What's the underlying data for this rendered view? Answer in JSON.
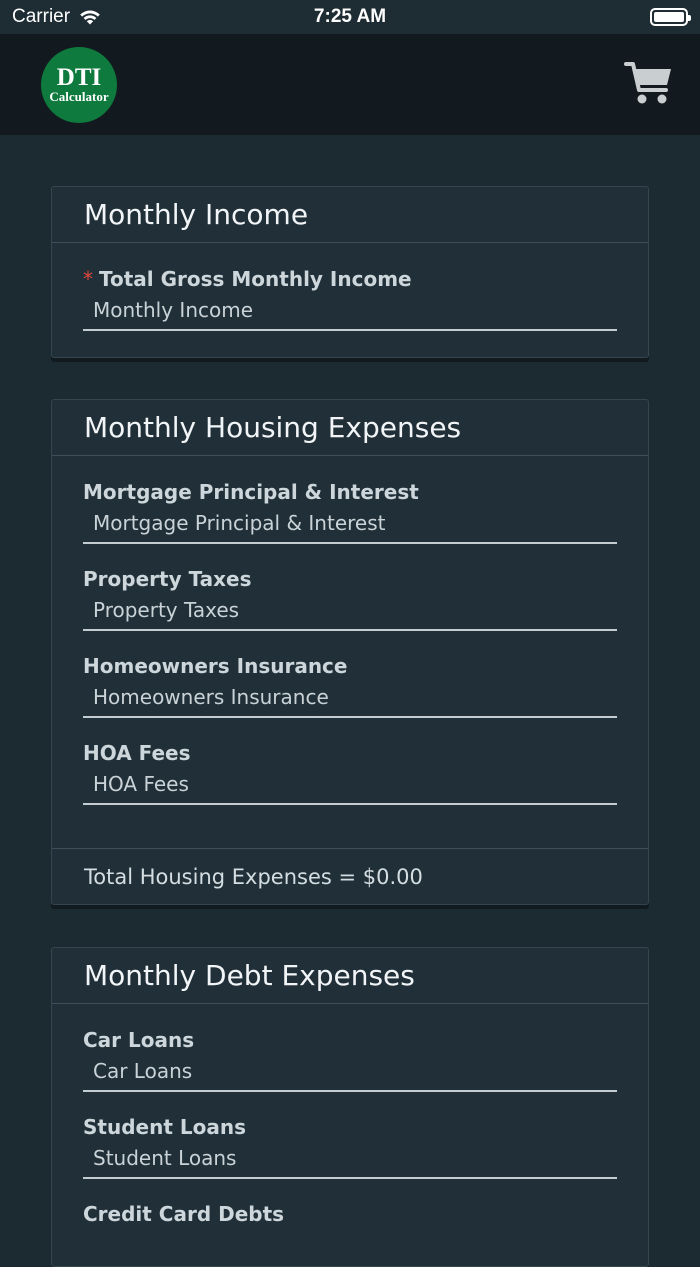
{
  "status_bar": {
    "carrier": "Carrier",
    "time": "7:25 AM"
  },
  "header": {
    "logo_title": "DTI",
    "logo_subtitle": "Calculator",
    "cart_icon": "shopping-cart-icon"
  },
  "colors": {
    "background": "#1c2a32",
    "header": "#121a1f",
    "card": "#213038",
    "logo_green": "#0f7a3e",
    "required_red": "#e0473a"
  },
  "income": {
    "title": "Monthly Income",
    "required_mark": "*",
    "label": "Total Gross Monthly Income",
    "placeholder": "Monthly Income",
    "value": ""
  },
  "housing": {
    "title": "Monthly Housing Expenses",
    "fields": [
      {
        "label": "Mortgage Principal & Interest",
        "placeholder": "Mortgage Principal & Interest",
        "value": ""
      },
      {
        "label": "Property Taxes",
        "placeholder": "Property Taxes",
        "value": ""
      },
      {
        "label": "Homeowners Insurance",
        "placeholder": "Homeowners Insurance",
        "value": ""
      },
      {
        "label": "HOA Fees",
        "placeholder": "HOA Fees",
        "value": ""
      }
    ],
    "total": "Total Housing Expenses = $0.00"
  },
  "debt": {
    "title": "Monthly Debt Expenses",
    "fields": [
      {
        "label": "Car Loans",
        "placeholder": "Car Loans",
        "value": ""
      },
      {
        "label": "Student Loans",
        "placeholder": "Student Loans",
        "value": ""
      },
      {
        "label": "Credit Card Debts",
        "placeholder": "",
        "value": ""
      }
    ]
  }
}
